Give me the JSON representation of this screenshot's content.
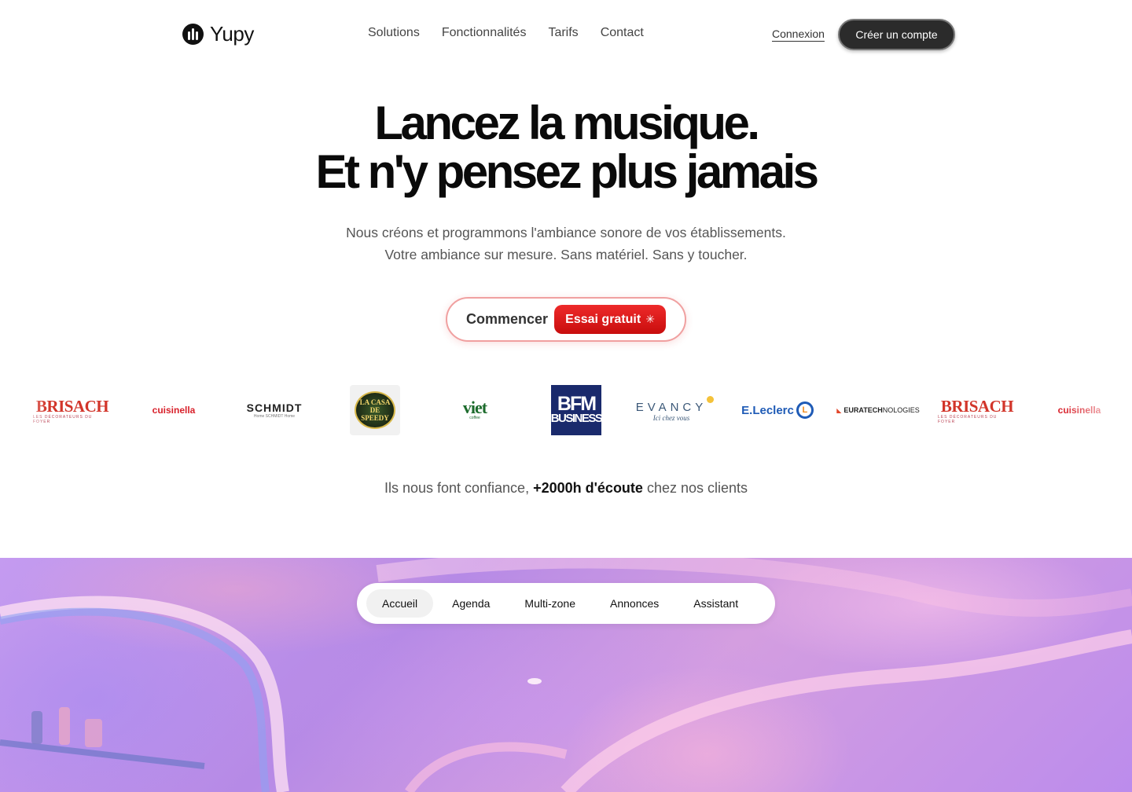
{
  "header": {
    "brand": "Yupy",
    "nav": [
      "Solutions",
      "Fonctionnalités",
      "Tarifs",
      "Contact"
    ],
    "login_label": "Connexion",
    "signup_label": "Créer un compte"
  },
  "hero": {
    "title_line1": "Lancez la musique.",
    "title_line2": "Et n'y pensez plus jamais",
    "subtitle_line1": "Nous créons et programmons l'ambiance sonore de vos établissements.",
    "subtitle_line2": "Votre ambiance sur mesure. Sans matériel. Sans y toucher.",
    "cta_label": "Commencer",
    "cta_badge": "Essai gratuit"
  },
  "logos": {
    "brisach_name": "BRISACH",
    "brisach_tagline": "LES DÉCORATEURS DU FOYER",
    "cuisinella": "cuisinella",
    "schmidt_name": "SCHMIDT",
    "schmidt_tagline": "Home SCHMIDT Home",
    "speedy": "LA CASA DE SPEEDY",
    "viet_name": "viet",
    "viet_tagline": "coffee",
    "bfm_line1": "BFM",
    "bfm_line2": "BUSINESS",
    "evancy_name": "EVANCY",
    "evancy_tagline": "Ici chez vous",
    "leclerc_name": "E.Leclerc",
    "leclerc_mark": "L",
    "eura_bold": "EURATECH",
    "eura_light": "NOLOGIES"
  },
  "trust": {
    "prefix": "Ils nous font confiance,",
    "highlight": "+2000h d'écoute",
    "suffix": "chez nos clients"
  },
  "tabs": [
    "Accueil",
    "Agenda",
    "Multi-zone",
    "Annonces",
    "Assistant"
  ],
  "colors": {
    "accent_red": "#e01b1b",
    "dark_button": "#2b2b2b",
    "band_purple": "#b68ae6"
  }
}
